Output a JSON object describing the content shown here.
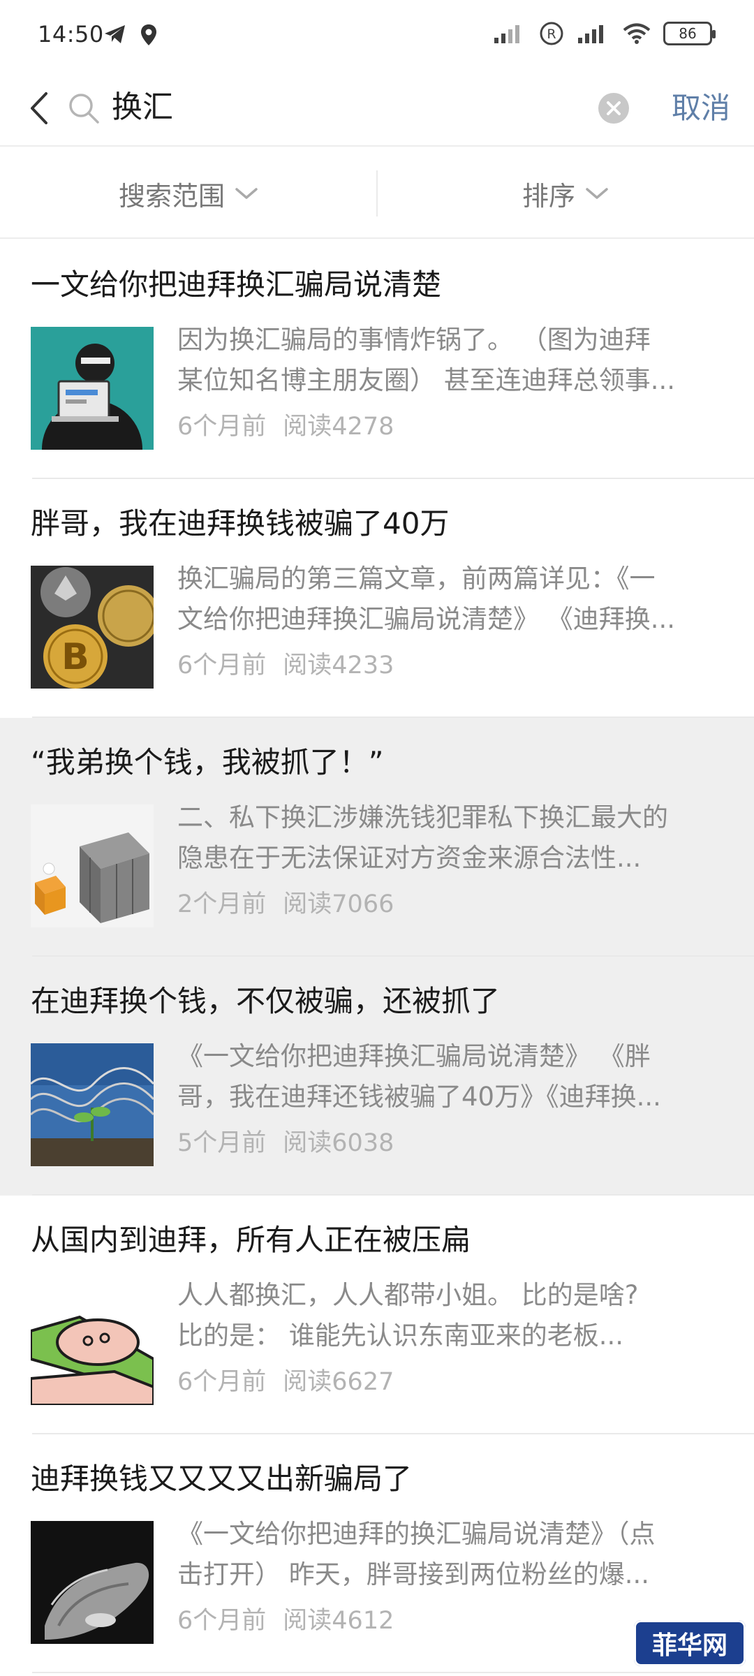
{
  "status_bar": {
    "time": "14:50",
    "battery": "86"
  },
  "search": {
    "query": "换汇",
    "cancel_label": "取消"
  },
  "filters": {
    "scope_label": "搜索范围",
    "sort_label": "排序"
  },
  "results": [
    {
      "title": "一文给你把迪拜换汇骗局说清楚",
      "summary_line1": "因为换汇骗局的事情炸锅了。 （图为迪拜",
      "summary_line2": "某位知名博主朋友圈） 甚至连迪拜总领事...",
      "time": "6个月前",
      "reads": "阅读4278"
    },
    {
      "title": "胖哥，我在迪拜换钱被骗了40万",
      "summary_line1": "换汇骗局的第三篇文章，前两篇详见：《一",
      "summary_line2": "文给你把迪拜换汇骗局说清楚》 《迪拜换...",
      "time": "6个月前",
      "reads": "阅读4233"
    },
    {
      "title": "“我弟换个钱，我被抓了！”",
      "summary_line1": "二、私下换汇涉嫌洗钱犯罪私下换汇最大的",
      "summary_line2": "隐患在于无法保证对方资金来源合法性...",
      "time": "2个月前",
      "reads": "阅读7066"
    },
    {
      "title": "在迪拜换个钱，不仅被骗，还被抓了",
      "summary_line1": "《一文给你把迪拜换汇骗局说清楚》 《胖",
      "summary_line2": "哥，我在迪拜还钱被骗了40万》《迪拜换...",
      "time": "5个月前",
      "reads": "阅读6038"
    },
    {
      "title": "从国内到迪拜，所有人正在被压扁",
      "summary_line1": "人人都换汇，人人都带小姐。 比的是啥?",
      "summary_line2": "比的是： 谁能先认识东南亚来的老板...",
      "time": "6个月前",
      "reads": "阅读6627"
    },
    {
      "title": "迪拜换钱又又又又出新骗局了",
      "summary_line1": "《一文给你把迪拜的换汇骗局说清楚》（点",
      "summary_line2": "击打开） 昨天，胖哥接到两位粉丝的爆...",
      "time": "6个月前",
      "reads": "阅读4612"
    }
  ],
  "watermark": "菲华网"
}
